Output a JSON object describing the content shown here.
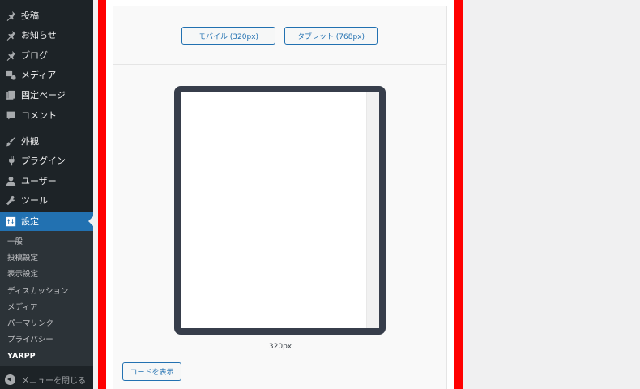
{
  "sidebar": {
    "items": [
      {
        "label": "投稿",
        "icon": "pin-icon"
      },
      {
        "label": "お知らせ",
        "icon": "pin-icon"
      },
      {
        "label": "ブログ",
        "icon": "pin-icon"
      },
      {
        "label": "メディア",
        "icon": "media-icon"
      },
      {
        "label": "固定ページ",
        "icon": "page-icon"
      },
      {
        "label": "コメント",
        "icon": "comment-icon"
      },
      {
        "label": "外観",
        "icon": "brush-icon"
      },
      {
        "label": "プラグイン",
        "icon": "plugin-icon"
      },
      {
        "label": "ユーザー",
        "icon": "user-icon"
      },
      {
        "label": "ツール",
        "icon": "wrench-icon"
      },
      {
        "label": "設定",
        "icon": "settings-icon"
      }
    ],
    "submenu": [
      "一般",
      "投稿設定",
      "表示設定",
      "ディスカッション",
      "メディア",
      "パーマリンク",
      "プライバシー",
      "YARPP"
    ],
    "collapse_label": "メニューを閉じる"
  },
  "preview": {
    "mobile_button": "モバイル (320px)",
    "tablet_button": "タブレット (768px)",
    "width_label": "320px",
    "code_button": "コードを表示"
  },
  "colors": {
    "sidebar_bg": "#1d2327",
    "accent": "#2271b1",
    "frame": "#ff0000",
    "device": "#373e4b"
  }
}
